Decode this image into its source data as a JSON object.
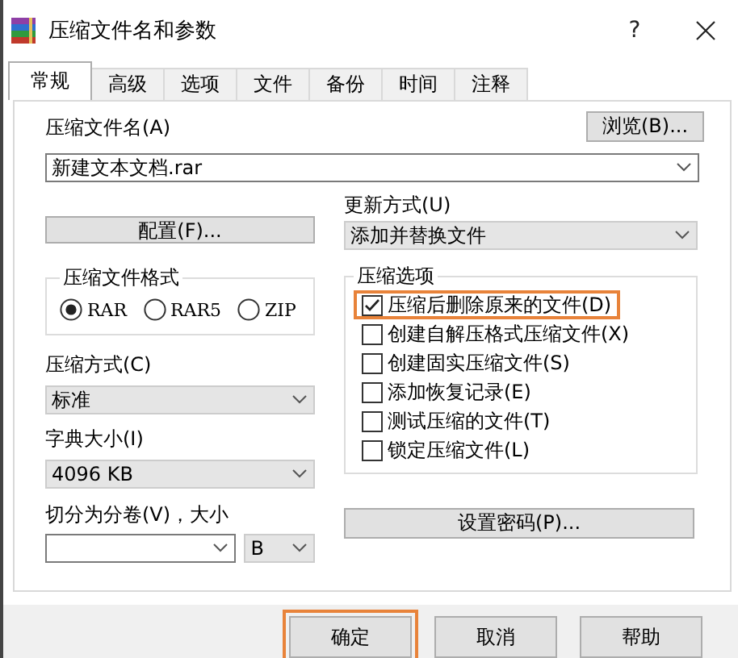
{
  "window": {
    "title": "压缩文件名和参数",
    "help_button": "?"
  },
  "tabs": [
    {
      "label": "常规",
      "selected": true
    },
    {
      "label": "高级",
      "selected": false
    },
    {
      "label": "选项",
      "selected": false
    },
    {
      "label": "文件",
      "selected": false
    },
    {
      "label": "备份",
      "selected": false
    },
    {
      "label": "时间",
      "selected": false
    },
    {
      "label": "注释",
      "selected": false
    }
  ],
  "general": {
    "archive_name_label": "压缩文件名(A)",
    "browse_button": "浏览(B)...",
    "archive_name": "新建文本文档.rar",
    "update_mode_label": "更新方式(U)",
    "update_mode": "添加并替换文件",
    "profiles_button": "配置(F)...",
    "format_group": {
      "title": "压缩文件格式",
      "options": [
        {
          "label": "RAR",
          "selected": true
        },
        {
          "label": "RAR5",
          "selected": false
        },
        {
          "label": "ZIP",
          "selected": false
        }
      ]
    },
    "method_label": "压缩方式(C)",
    "method": "标准",
    "dictionary_label": "字典大小(I)",
    "dictionary": "4096 KB",
    "split_label": "切分为分卷(V)，大小",
    "split_unit": "B",
    "options_group": {
      "title": "压缩选项",
      "items": [
        {
          "label": "压缩后删除原来的文件(D)",
          "checked": true,
          "highlighted": true
        },
        {
          "label": "创建自解压格式压缩文件(X)",
          "checked": false,
          "highlighted": false
        },
        {
          "label": "创建固实压缩文件(S)",
          "checked": false,
          "highlighted": false
        },
        {
          "label": "添加恢复记录(E)",
          "checked": false,
          "highlighted": false
        },
        {
          "label": "测试压缩的文件(T)",
          "checked": false,
          "highlighted": false
        },
        {
          "label": "锁定压缩文件(L)",
          "checked": false,
          "highlighted": false
        }
      ]
    },
    "password_button": "设置密码(P)..."
  },
  "buttons": [
    {
      "label": "确定",
      "highlighted": true
    },
    {
      "label": "取消",
      "highlighted": false
    },
    {
      "label": "帮助",
      "highlighted": false
    }
  ]
}
